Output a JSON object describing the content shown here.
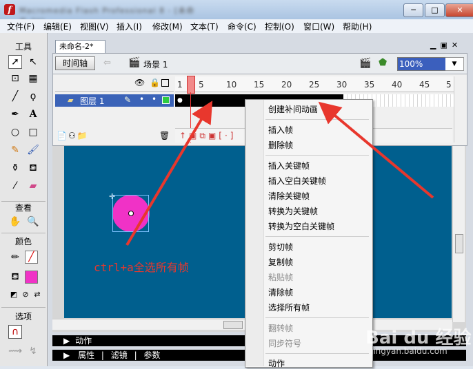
{
  "titlebar": {
    "title": "Macromedia Flash Professional 8 - [未命名-2*]",
    "minimize": "─",
    "maximize": "□",
    "close": "✕"
  },
  "menubar": [
    "文件(F)",
    "编辑(E)",
    "视图(V)",
    "插入(I)",
    "修改(M)",
    "文本(T)",
    "命令(C)",
    "控制(O)",
    "窗口(W)",
    "帮助(H)"
  ],
  "tools": {
    "title": "工具",
    "view_label": "查看",
    "color_label": "颜色",
    "options_label": "选项"
  },
  "document": {
    "tab": "未命名-2*",
    "timeline_button": "时间轴",
    "scene": "场景 1",
    "zoom": "100%"
  },
  "timeline": {
    "layer_name": "图层 1",
    "ruler_ticks": [
      "1",
      "5",
      "10",
      "15",
      "20",
      "25",
      "30",
      "35",
      "40",
      "45",
      "5"
    ]
  },
  "panels": {
    "actions": "动作",
    "properties": "属性",
    "filters": "滤镜",
    "params": "参数"
  },
  "context_menu": {
    "groups": [
      [
        {
          "label": "创建补间动画",
          "enabled": true
        }
      ],
      [
        {
          "label": "插入帧",
          "enabled": true
        },
        {
          "label": "删除帧",
          "enabled": true
        }
      ],
      [
        {
          "label": "插入关键帧",
          "enabled": true
        },
        {
          "label": "插入空白关键帧",
          "enabled": true
        },
        {
          "label": "清除关键帧",
          "enabled": true
        },
        {
          "label": "转换为关键帧",
          "enabled": true
        },
        {
          "label": "转换为空白关键帧",
          "enabled": true
        }
      ],
      [
        {
          "label": "剪切帧",
          "enabled": true
        },
        {
          "label": "复制帧",
          "enabled": true
        },
        {
          "label": "粘贴帧",
          "enabled": false
        },
        {
          "label": "清除帧",
          "enabled": true
        },
        {
          "label": "选择所有帧",
          "enabled": true
        }
      ],
      [
        {
          "label": "翻转帧",
          "enabled": false
        },
        {
          "label": "同步符号",
          "enabled": false
        }
      ],
      [
        {
          "label": "动作",
          "enabled": true
        }
      ]
    ]
  },
  "annotation": "ctrl+a全选所有帧",
  "watermark": {
    "brand": "Bai du 经验",
    "url": "jingyan.baidu.com"
  },
  "colors": {
    "stage": "#005f8e",
    "circle_fill": "#f032c6",
    "arrow": "#e8372d",
    "layer_highlight": "#3b63b8"
  }
}
